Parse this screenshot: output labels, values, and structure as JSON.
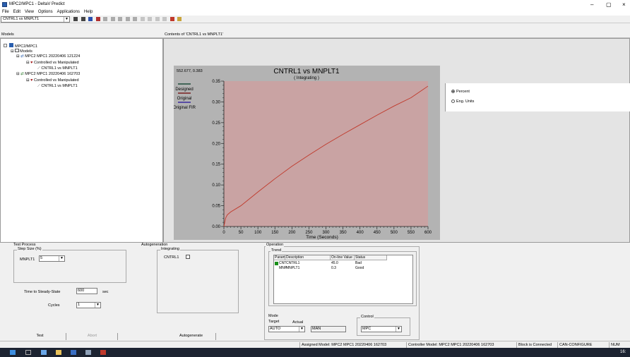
{
  "window": {
    "title": "MPC2/MPC1 - DeltaV Predict",
    "minimize": "–",
    "maximize": "▢",
    "close": "×"
  },
  "menu": [
    "File",
    "Edit",
    "View",
    "Options",
    "Applications",
    "Help"
  ],
  "toolbar": {
    "model_combo": "CNTRL1 vs MNPLT1",
    "icons": [
      "open-icon",
      "print-icon",
      "download-icon",
      "model-icon",
      "nav-first-icon",
      "nav-prev-icon",
      "nav-next-icon",
      "nav-last-icon",
      "nav-end-icon",
      "edit-icon",
      "split-icon",
      "merge-icon",
      "add-icon",
      "fire-icon",
      "lock-icon"
    ]
  },
  "tree_pane": {
    "header": "Models",
    "items": [
      {
        "label": "MPC2/MPC1",
        "prefix": "□"
      },
      {
        "label": "Models",
        "prefix": "⊟"
      },
      {
        "label": "MPC2 MPC1 20220406 121224",
        "prefix": "⊟"
      },
      {
        "label": "Controlled vs Manipulated",
        "prefix": "⊟"
      },
      {
        "label": "CNTRL1 vs MNPLT1",
        "prefix": ""
      },
      {
        "label": "MPC2 MPC1 20220406 162703",
        "prefix": "⊟"
      },
      {
        "label": "Controlled vs Manipulated",
        "prefix": "⊟"
      },
      {
        "label": "CNTRL1 vs MNPLT1",
        "prefix": ""
      }
    ]
  },
  "content_pane": {
    "header": "Contents of 'CNTRL1 vs MNPLT1'"
  },
  "chart_data": {
    "type": "line",
    "title": "CNTRL1 vs MNPLT1",
    "subtitle": "( Integrating )",
    "coord_readout": "552.677, 0.383",
    "xlabel": "Time (Seconds)",
    "ylabel": "",
    "xlim": [
      0,
      600
    ],
    "ylim": [
      0,
      0.35
    ],
    "xticks": [
      0,
      50,
      100,
      150,
      200,
      250,
      300,
      350,
      400,
      450,
      500,
      550,
      600
    ],
    "yticks": [
      "0.00",
      "0.05",
      "0.10",
      "0.15",
      "0.20",
      "0.25",
      "0.30",
      "0.35"
    ],
    "legend": [
      {
        "name": "Designed",
        "color": "#1e4d3a"
      },
      {
        "name": "Original",
        "color": "#7a1f1f"
      },
      {
        "name": "Original FIR",
        "color": "#3a2aa0"
      }
    ],
    "plot_bg": "#c9a3a3",
    "series": [
      {
        "name": "Original",
        "color": "#c0392b",
        "x": [
          0,
          5,
          10,
          20,
          50,
          100,
          150,
          200,
          250,
          300,
          350,
          400,
          450,
          500,
          550,
          600
        ],
        "y": [
          0.0,
          0.02,
          0.028,
          0.035,
          0.05,
          0.083,
          0.115,
          0.145,
          0.172,
          0.198,
          0.222,
          0.245,
          0.268,
          0.29,
          0.31,
          0.338
        ]
      }
    ]
  },
  "display_units": {
    "percent": "Percent",
    "eng_units": "Eng. Units",
    "selected": "percent"
  },
  "test_process": {
    "title": "Test Process",
    "step_size_label": "Step Size (%)",
    "param_label": "MNPLT1",
    "param_value": "5",
    "time_ss_label": "Time to Steady-State",
    "time_ss_value": "600",
    "time_ss_unit": "sec",
    "cycles_label": "Cycles",
    "cycles_value": "1",
    "test_button": "Test",
    "abort_button": "Abort"
  },
  "autogeneration": {
    "title": "Autogeneration",
    "integrating_label": "Integrating",
    "cntrl_label": "CNTRL1",
    "button": "Autogenerate"
  },
  "operation": {
    "title": "Operation",
    "trend_label": "Trend",
    "columns": [
      "Param...",
      "Description",
      "On-line Value",
      "Status"
    ],
    "rows": [
      {
        "param": "CNT",
        "desc": "CNTRL1",
        "value": "45.0",
        "status": "Bad",
        "color": "#1a8f1a"
      },
      {
        "param": "MNP",
        "desc": "MNPLT1",
        "value": "0.3",
        "status": "Good",
        "color": ""
      }
    ],
    "mode_label": "Mode",
    "target_label": "Target",
    "actual_label": "Actual",
    "target_value": "AUTO",
    "actual_value": "MAN",
    "control_label": "Control",
    "control_value": "MPC"
  },
  "status_bar": {
    "assigned": "Assigned Model: MPC2 MPC1 20220406 162703",
    "controller": "Controller Model: MPC2 MPC1 20220406 162703",
    "block": "Block is Connected",
    "config": "CAN-CONFIGURE",
    "num": "NUM"
  },
  "taskbar": {
    "clock": "16:"
  }
}
